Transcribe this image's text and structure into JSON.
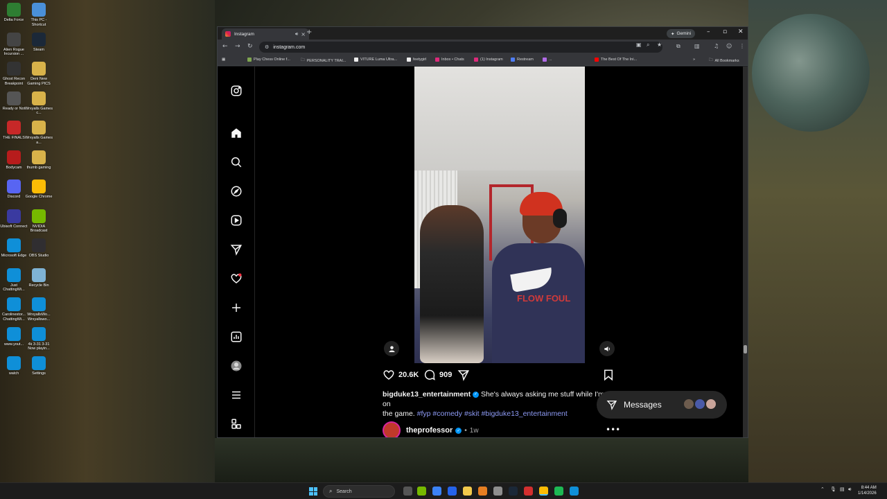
{
  "desktop": {
    "icons": [
      {
        "label": "Delta Force",
        "color": "#2e7d32"
      },
      {
        "label": "This PC - Shortcut",
        "color": "#4a90d9"
      },
      {
        "label": "Alien Rogue Incursion ...",
        "color": "#444444"
      },
      {
        "label": "Steam",
        "color": "#1b2838"
      },
      {
        "label": "Ghost Recon Breakpoint",
        "color": "#333333"
      },
      {
        "label": "Deni New Gaming PICS",
        "color": "#d8b24a"
      },
      {
        "label": "Ready or Not",
        "color": "#555555"
      },
      {
        "label": "Wrxyalls Games c...",
        "color": "#d8b24a"
      },
      {
        "label": "THE FINALS",
        "color": "#c62828"
      },
      {
        "label": "Wrxyalls Games a...",
        "color": "#d8b24a"
      },
      {
        "label": "Bodycam",
        "color": "#b71c1c"
      },
      {
        "label": "thumb gaming",
        "color": "#d8b24a"
      },
      {
        "label": "Discord",
        "color": "#5865f2"
      },
      {
        "label": "Google Chrome",
        "color": "#fbbc05"
      },
      {
        "label": "Ubisoft Connect",
        "color": "#3a3aa0"
      },
      {
        "label": "NVIDIA Broadcast",
        "color": "#76b900"
      },
      {
        "label": "Microsoft Edge",
        "color": "#0f8fd8"
      },
      {
        "label": "OBS Studio",
        "color": "#302e31"
      },
      {
        "label": "Just ChattingWi...",
        "color": "#0f8fd8"
      },
      {
        "label": "Recycle Bin",
        "color": "#7fb3d5"
      },
      {
        "label": "Carolinestor... ChattingWi...",
        "color": "#0f8fd8"
      },
      {
        "label": "WrxyallsWo... Wrxyallswo...",
        "color": "#0f8fd8"
      },
      {
        "label": "www.yout...",
        "color": "#0f8fd8"
      },
      {
        "label": "4k 3-31 3-31 Now playin...",
        "color": "#0f8fd8"
      },
      {
        "label": "watch",
        "color": "#0f8fd8"
      },
      {
        "label": "Settings",
        "color": "#0f8fd8"
      }
    ]
  },
  "browser": {
    "tab_title": "Instagram",
    "new_tab": "+",
    "gemini_label": "Gemini",
    "url": "instagram.com",
    "bookmarks": [
      {
        "label": "Play Chess Online f...",
        "color": "#7fa650"
      },
      {
        "label": "PERSONALITY TRAI...",
        "color": "#bdc1c6"
      },
      {
        "label": "VITURE Luma Ultra...",
        "color": "#eeeeee"
      },
      {
        "label": "feetygirl",
        "color": "#eeeeee"
      },
      {
        "label": "Inbox • Chats",
        "color": "#dd2a7b"
      },
      {
        "label": "(1) Instagram",
        "color": "#dd2a7b"
      },
      {
        "label": "Restream",
        "color": "#4f7df3"
      },
      {
        "label": "...",
        "color": "#b26be8"
      },
      {
        "label": "The Best Of The Ini...",
        "color": "#ff0000"
      }
    ],
    "all_bookmarks": "All Bookmarks"
  },
  "post": {
    "likes": "20.6K",
    "comments": "909",
    "username": "bigduke13_entertainment",
    "caption_text": " She's always asking me stuff while I'm on",
    "caption_line2": "the game. ",
    "hashtags": [
      "#fyp",
      "#comedy",
      "#skit",
      "#bigduke13_entertainment"
    ],
    "shirt_text": "FLOW FOUL"
  },
  "next_post": {
    "username": "theprofessor",
    "time": "1w"
  },
  "messages": {
    "label": "Messages"
  },
  "taskbar": {
    "search_placeholder": "Search",
    "time": "8:44 AM",
    "date": "1/14/2026"
  },
  "colors": {
    "ig_background": "#000000",
    "hashtag_blue": "#8e9bf5",
    "verified_blue": "#0095f6",
    "notification_red": "#ff3040"
  }
}
